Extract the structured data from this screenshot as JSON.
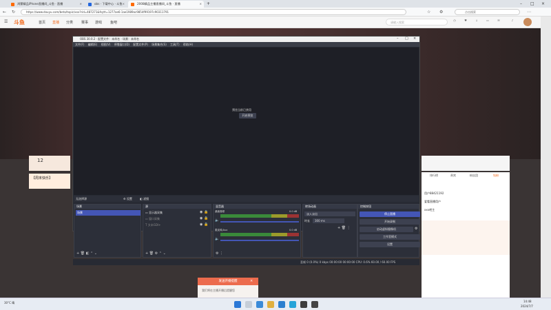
{
  "browser": {
    "tabs": [
      {
        "title": "鸿蒙精品iPhone直播间_斗鱼 · 直播",
        "fav": "#ff6a00"
      },
      {
        "title": "obs · 下载中心 · 斗鱼",
        "fav": "#2266dd"
      },
      {
        "title": "2008精品主播直播间_斗鱼 · 直播",
        "fav": "#ff6a00"
      }
    ],
    "url": "https://www.douyu.com/beta/topic/xxx?rid=487271&fsytt=1277ae6-1ae1989ac9854f99197c90311791",
    "search_placeholder": "点击搜索"
  },
  "site": {
    "logo": "斗鱼",
    "nav": [
      "首页",
      "直播",
      "分类",
      "赛事",
      "游戏",
      "鱼吧"
    ],
    "active_nav": "直播",
    "search": "请输入搜索",
    "icons": [
      "历史",
      "关注",
      "下载",
      "客户端",
      "消息",
      "个播"
    ]
  },
  "obs": {
    "title": "OBS 30.0.2 · 配置文件：未命名 · 场景：未命名",
    "menu": [
      "文件(F)",
      "编辑(E)",
      "视图(V)",
      "停靠窗口(D)",
      "配置文件(P)",
      "场景集合(S)",
      "工具(T)",
      "帮助(H)"
    ],
    "preview_msg": "预览当前已禁用",
    "preview_btn": "开启预览",
    "status_row": {
      "label": "无选择源",
      "props": "⚙ 设置",
      "filters": "◧ 滤镜"
    },
    "docks": {
      "scenes": {
        "title": "场景",
        "items": [
          "场景"
        ]
      },
      "sources": {
        "title": "源",
        "items": [
          "显示器采集",
          "窗口采集",
          "文本GDI+"
        ]
      },
      "mixer": {
        "title": "混音器",
        "ch": [
          {
            "name": "桌面音频",
            "db": "0.0 dB"
          },
          {
            "name": "麦克风/Aux",
            "db": "0.0 dB"
          }
        ]
      },
      "transitions": {
        "title": "转场动画",
        "type": "淡入淡出",
        "duration_label": "时长",
        "duration": "300 ms"
      },
      "controls": {
        "title": "控制按钮",
        "buttons": [
          "停止直播",
          "开始录制",
          "启动虚拟摄像机",
          "工作室模式",
          "设置"
        ]
      }
    },
    "status": "丢帧 0 (0.0%)   0 kbps   00:00:00   00:00:00   CPU: 0.6%   60.00 / 60.00 FPS"
  },
  "room": {
    "followers": "12",
    "anchor_name": "【周末快乐】",
    "side_tabs": [
      "排行榜",
      "贵宾",
      "粉丝团",
      "钻粉"
    ],
    "ranks": [
      "用户88421192",
      "爱看直播用户",
      "xxx吧主"
    ],
    "popup": "发送开播提醒",
    "popup_body": "我们将在主播开播后提醒您"
  },
  "taskbar": {
    "weather": "30°C 晴",
    "time": "14:48",
    "date": "2024/7/7"
  }
}
